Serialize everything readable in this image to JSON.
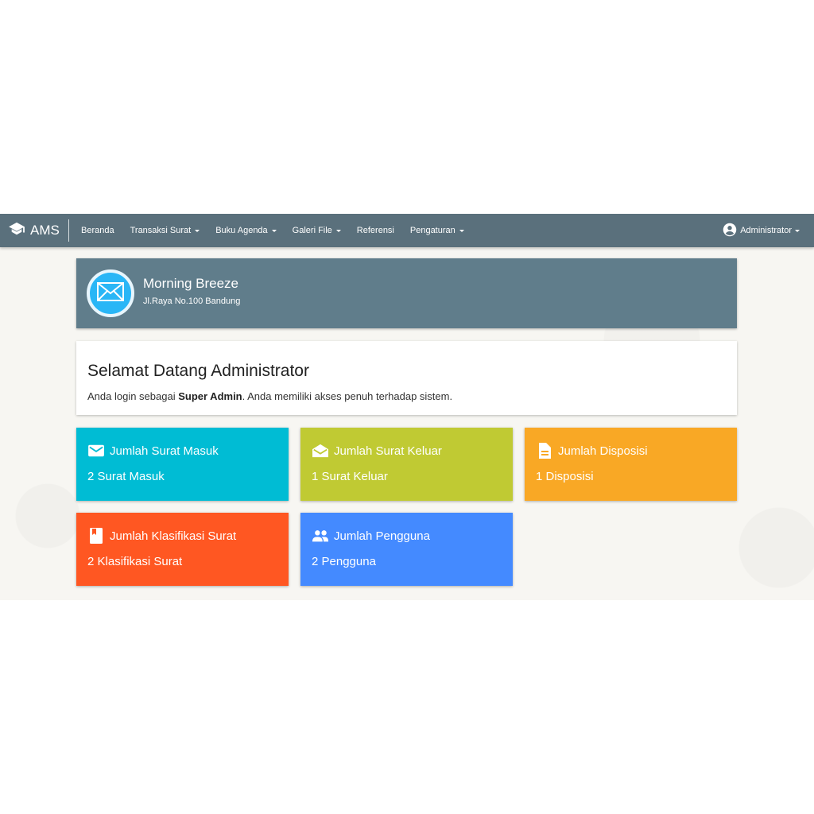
{
  "app": {
    "brand": "AMS",
    "nav": [
      "Beranda",
      "Transaksi Surat",
      "Buku Agenda",
      "Galeri File",
      "Referensi",
      "Pengaturan"
    ],
    "user": "Administrator"
  },
  "profile": {
    "name": "Morning Breeze",
    "address": "Jl.Raya No.100 Bandung"
  },
  "welcome": {
    "title": "Selamat Datang Administrator",
    "text_before": "Anda login sebagai ",
    "role": "Super Admin",
    "text_after": ". Anda memiliki akses penuh terhadap sistem."
  },
  "stats": [
    {
      "label": "Jumlah Surat Masuk",
      "value": "2 Surat Masuk",
      "color": "#00bcd4",
      "icon": "mail-icon"
    },
    {
      "label": "Jumlah Surat Keluar",
      "value": "1 Surat Keluar",
      "color": "#c0ca33",
      "icon": "drafts-icon"
    },
    {
      "label": "Jumlah Disposisi",
      "value": "1 Disposisi",
      "color": "#f9a825",
      "icon": "description-icon"
    },
    {
      "label": "Jumlah Klasifikasi Surat",
      "value": "2 Klasifikasi Surat",
      "color": "#ff5722",
      "icon": "book-icon"
    },
    {
      "label": "Jumlah Pengguna",
      "value": "2 Pengguna",
      "color": "#448aff",
      "icon": "people-icon"
    }
  ]
}
